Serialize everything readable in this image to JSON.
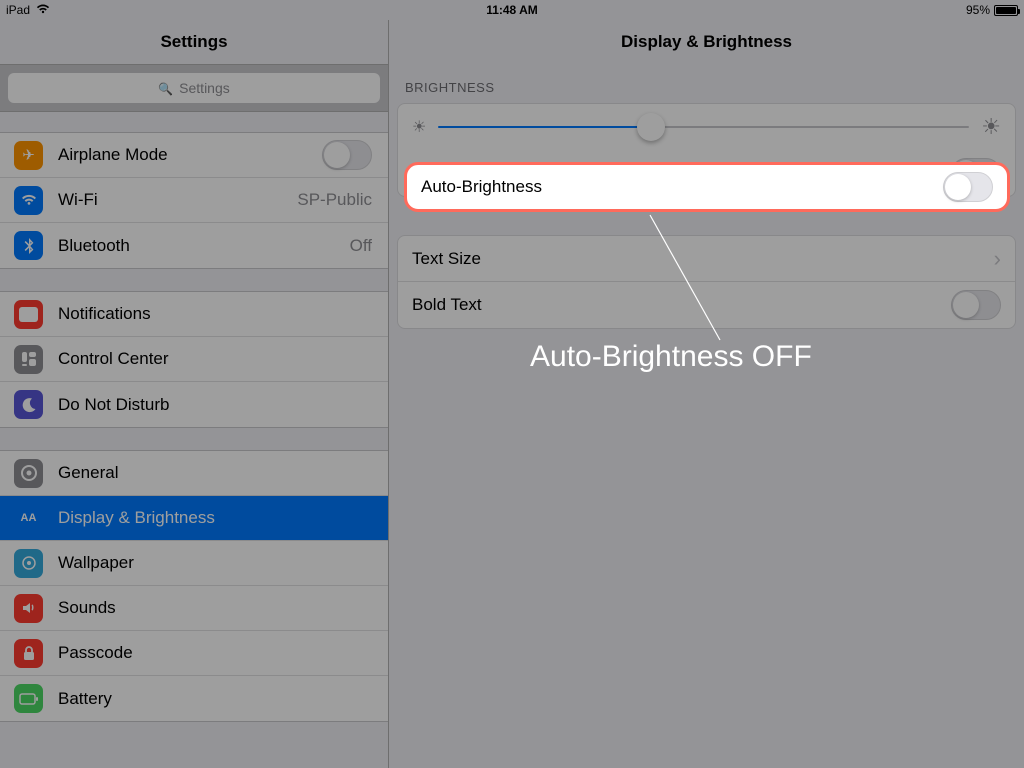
{
  "status": {
    "device": "iPad",
    "time": "11:48 AM",
    "battery_pct": "95%"
  },
  "sidebar": {
    "title": "Settings",
    "search_placeholder": "Settings",
    "group1": [
      {
        "label": "Airplane Mode",
        "value": "",
        "icon": "airplane",
        "toggle": true
      },
      {
        "label": "Wi-Fi",
        "value": "SP-Public",
        "icon": "wifi"
      },
      {
        "label": "Bluetooth",
        "value": "Off",
        "icon": "bt"
      }
    ],
    "group2": [
      {
        "label": "Notifications",
        "icon": "notif"
      },
      {
        "label": "Control Center",
        "icon": "cc"
      },
      {
        "label": "Do Not Disturb",
        "icon": "dnd"
      }
    ],
    "group3": [
      {
        "label": "General",
        "icon": "general"
      },
      {
        "label": "Display & Brightness",
        "icon": "display",
        "selected": true
      },
      {
        "label": "Wallpaper",
        "icon": "wall"
      },
      {
        "label": "Sounds",
        "icon": "sound"
      },
      {
        "label": "Passcode",
        "icon": "passcode"
      },
      {
        "label": "Battery",
        "icon": "battery"
      }
    ]
  },
  "detail": {
    "title": "Display & Brightness",
    "sections": {
      "brightness_header": "BRIGHTNESS",
      "auto_brightness": "Auto-Brightness",
      "text_size": "Text Size",
      "bold_text": "Bold Text"
    }
  },
  "annotation": {
    "text": "Auto-Brightness OFF"
  }
}
